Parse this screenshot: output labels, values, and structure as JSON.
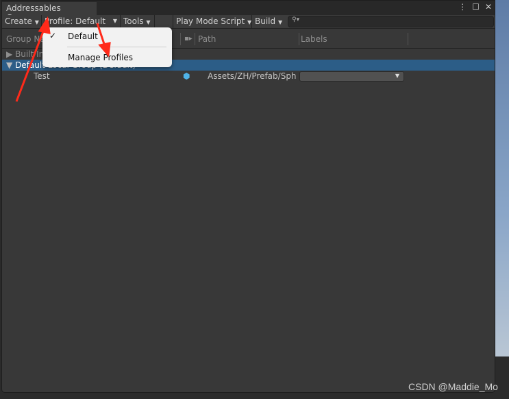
{
  "window": {
    "title": "Addressables Groups",
    "buttons": {
      "more": "⋮",
      "maximize": "☐",
      "close": "✕"
    }
  },
  "toolbar": {
    "create": "Create",
    "profile": "Profile: Default",
    "tools": "Tools",
    "play_mode_script": "Play Mode Script",
    "build": "Build",
    "search_placeholder": ""
  },
  "columns": {
    "group_name": "Group Name",
    "path": "Path",
    "labels": "Labels"
  },
  "rows": [
    {
      "name": "Built In Data",
      "expanded": false
    },
    {
      "name": "Default Local Group (Default)",
      "expanded": true,
      "selected": true
    },
    {
      "name": "Test",
      "path": "Assets/ZH/Prefab/Sphere",
      "labels": ""
    }
  ],
  "profile_menu": {
    "items": [
      {
        "label": "Default",
        "checked": true
      },
      {
        "label": "Manage Profiles"
      }
    ]
  },
  "watermark": "CSDN @Maddie_Mo",
  "colors": {
    "selection": "#2c5d87",
    "annotation": "#ff2a1a",
    "panel": "#383838"
  }
}
